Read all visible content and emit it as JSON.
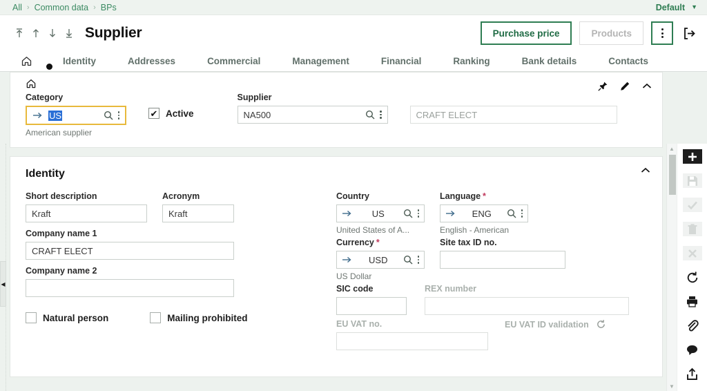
{
  "breadcrumb": {
    "items": [
      "All",
      "Common data",
      "BPs"
    ],
    "separator": "›",
    "profile_label": "Default"
  },
  "header": {
    "title": "Supplier",
    "nav_first_tooltip": "First",
    "nav_prev_tooltip": "Previous",
    "nav_next_tooltip": "Next",
    "nav_last_tooltip": "Last",
    "purchase_price_label": "Purchase price",
    "products_label": "Products",
    "actions_label": "Actions",
    "exit_label": "Exit"
  },
  "tabs": [
    {
      "label": "",
      "icon": "home-icon",
      "active": true
    },
    {
      "label": "Identity",
      "active": false
    },
    {
      "label": "Addresses",
      "active": false
    },
    {
      "label": "Commercial",
      "active": false
    },
    {
      "label": "Management",
      "active": false
    },
    {
      "label": "Financial",
      "active": false
    },
    {
      "label": "Ranking",
      "active": false
    },
    {
      "label": "Bank details",
      "active": false
    },
    {
      "label": "Contacts",
      "active": false
    }
  ],
  "top_panel": {
    "category": {
      "label": "Category",
      "value": "US",
      "selected": true,
      "hint": "American supplier",
      "focused": true
    },
    "active": {
      "label": "Active",
      "checked": true
    },
    "supplier": {
      "label": "Supplier",
      "code_value": "NA500",
      "name_placeholder": "CRAFT ELECT"
    }
  },
  "identity": {
    "section_title": "Identity",
    "short_description": {
      "label": "Short description",
      "value": "Kraft"
    },
    "acronym": {
      "label": "Acronym",
      "value": "Kraft"
    },
    "company_name_1": {
      "label": "Company name 1",
      "value": "CRAFT ELECT"
    },
    "company_name_2": {
      "label": "Company name 2",
      "value": ""
    },
    "natural_person": {
      "label": "Natural person",
      "checked": false
    },
    "mailing_prohibited": {
      "label": "Mailing prohibited",
      "checked": false
    },
    "country": {
      "label": "Country",
      "value": "US",
      "hint": "United States of A..."
    },
    "language": {
      "label": "Language",
      "value": "ENG",
      "hint": "English - American",
      "required": true
    },
    "currency": {
      "label": "Currency",
      "value": "USD",
      "hint": "US Dollar",
      "required": true
    },
    "site_tax_id": {
      "label": "Site tax ID no.",
      "value": ""
    },
    "sic_code": {
      "label": "SIC code",
      "value": ""
    },
    "rex_number": {
      "label": "REX number",
      "value": "",
      "disabled": true
    },
    "eu_vat_no": {
      "label": "EU VAT no.",
      "value": "",
      "disabled": true
    },
    "eu_vat_validation": {
      "label": "EU VAT ID validation",
      "disabled": true
    }
  },
  "right_rail": [
    {
      "name": "new-icon",
      "label": "New",
      "state": "active"
    },
    {
      "name": "save-icon",
      "label": "Save",
      "state": "disabled"
    },
    {
      "name": "validate-icon",
      "label": "Validate",
      "state": "disabled"
    },
    {
      "name": "delete-icon",
      "label": "Delete",
      "state": "disabled"
    },
    {
      "name": "cancel-icon",
      "label": "Cancel",
      "state": "disabled"
    },
    {
      "name": "refresh-icon",
      "label": "Refresh",
      "state": "normal"
    },
    {
      "name": "print-icon",
      "label": "Print",
      "state": "normal"
    },
    {
      "name": "attachment-icon",
      "label": "Attachments",
      "state": "normal"
    },
    {
      "name": "comment-icon",
      "label": "Comments",
      "state": "normal"
    },
    {
      "name": "export-icon",
      "label": "Export",
      "state": "normal"
    }
  ],
  "colors": {
    "accent_green": "#2e7d52",
    "breadcrumb_bg": "#eef3ef",
    "workarea_bg": "#edf2ee",
    "focus_yellow": "#e8b93b",
    "selection_blue": "#2a6fd6",
    "required_red": "#c0395c"
  }
}
